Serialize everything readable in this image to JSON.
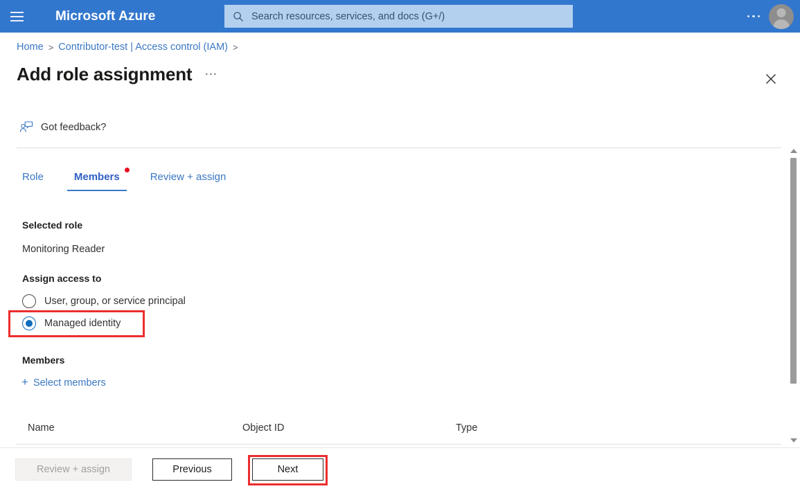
{
  "topbar": {
    "menu_icon": "hamburger-icon",
    "brand": "Microsoft Azure",
    "search": {
      "icon": "search-icon",
      "placeholder": "Search resources, services, and docs (G+/)",
      "value": ""
    },
    "more_icon": "ellipsis-icon",
    "avatar_icon": "user-avatar-icon",
    "background_color": "#3277ce"
  },
  "breadcrumb": {
    "items": [
      {
        "label": "Home",
        "separator": ">"
      },
      {
        "label": "Contributor-test | Access control (IAM)",
        "separator": ">"
      }
    ]
  },
  "header": {
    "title": "Add role assignment",
    "more_icon": "ellipsis-icon",
    "close_icon": "close-icon"
  },
  "feedback": {
    "icon": "feedback-person-icon",
    "label": "Got feedback?"
  },
  "tabs": [
    {
      "label": "Role",
      "active": false,
      "required": false
    },
    {
      "label": "Members",
      "active": true,
      "required": true
    },
    {
      "label": "Review + assign",
      "active": false,
      "required": false
    }
  ],
  "form": {
    "selected_role_label": "Selected role",
    "selected_role_value": "Monitoring Reader",
    "assign_access_label": "Assign access to",
    "radio_options": [
      {
        "label": "User, group, or service principal",
        "checked": false
      },
      {
        "label": "Managed identity",
        "checked": true
      }
    ],
    "members_label": "Members",
    "select_members_label": "Select members",
    "select_members_icon": "plus-icon"
  },
  "table": {
    "columns": [
      "Name",
      "Object ID",
      "Type"
    ],
    "rows": []
  },
  "footer": {
    "review_assign_label": "Review + assign",
    "review_assign_disabled": true,
    "previous_label": "Previous",
    "next_label": "Next"
  },
  "scrollbar": {
    "up_icon": "chevron-up-icon",
    "down_icon": "chevron-down-icon"
  },
  "annotations": {
    "color": "#ec2d2d",
    "highlighted": [
      "Managed identity",
      "Next"
    ]
  }
}
